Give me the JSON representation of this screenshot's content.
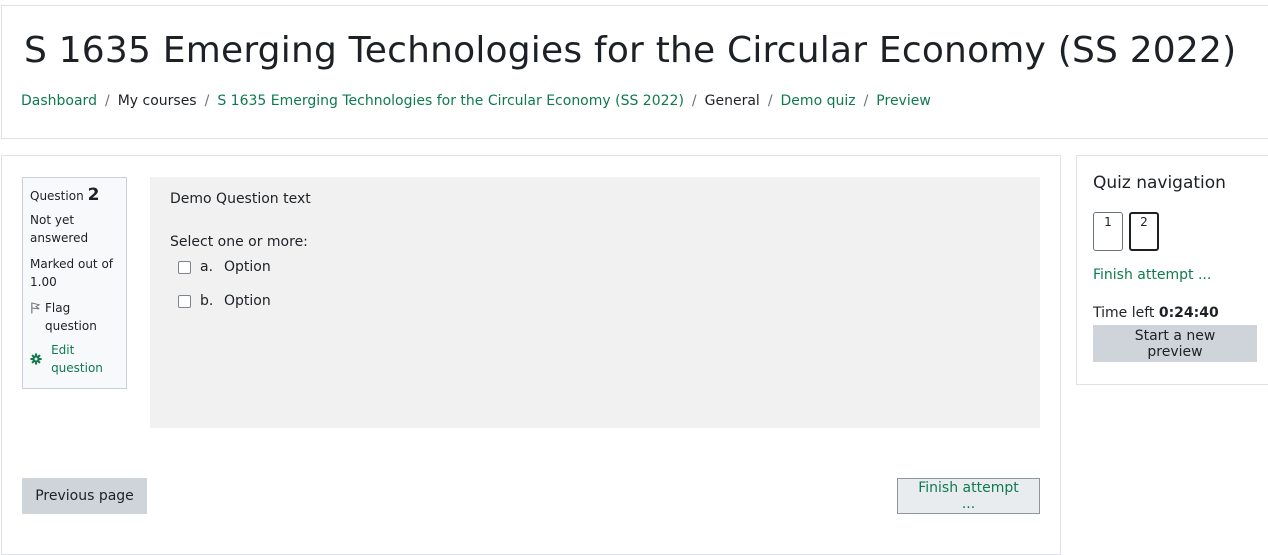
{
  "header": {
    "title": "S 1635 Emerging Technologies for the Circular Economy (SS 2022)",
    "breadcrumb": [
      {
        "label": "Dashboard",
        "link": true
      },
      {
        "label": "My courses",
        "link": false
      },
      {
        "label": "S 1635 Emerging Technologies for the Circular Economy (SS 2022)",
        "link": true
      },
      {
        "label": "General",
        "link": false
      },
      {
        "label": "Demo quiz",
        "link": true
      },
      {
        "label": "Preview",
        "link": true
      }
    ],
    "separator": "/"
  },
  "question_info": {
    "label": "Question",
    "number": "2",
    "state": "Not yet answered",
    "grade": "Marked out of 1.00",
    "flag_label": "Flag question",
    "edit_label": "Edit question"
  },
  "question": {
    "text": "Demo Question text",
    "prompt": "Select one or more:",
    "options": [
      {
        "letter": "a.",
        "label": "Option",
        "checked": false
      },
      {
        "letter": "b.",
        "label": "Option",
        "checked": false
      }
    ]
  },
  "buttons": {
    "previous": "Previous page",
    "finish": "Finish attempt ..."
  },
  "quiz_nav": {
    "title": "Quiz navigation",
    "questions": [
      "1",
      "2"
    ],
    "current": "2",
    "finish_link": "Finish attempt ...",
    "time_label": "Time left",
    "time_value": "0:24:40",
    "new_preview": "Start a new preview"
  },
  "colors": {
    "link": "#0f7a4f",
    "text": "#1d2125",
    "question_bg": "#f1f1f1"
  }
}
